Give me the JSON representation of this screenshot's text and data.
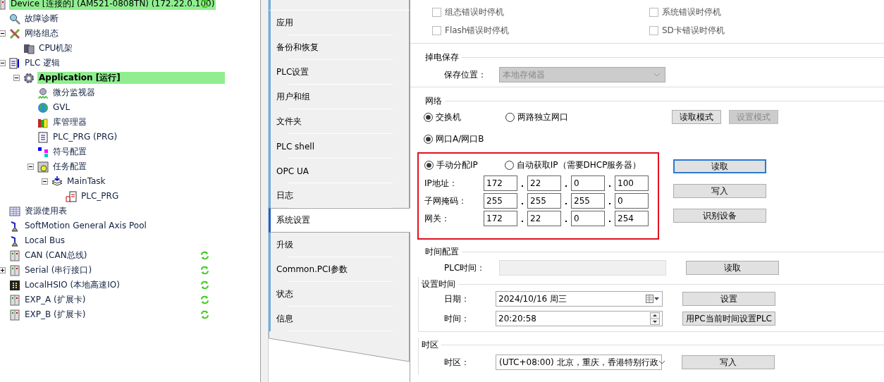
{
  "tree": [
    {
      "label": "Device [连接的] (AM521-0808TN) (172.22.0.100)",
      "kind": "device",
      "selected": true,
      "synced": true,
      "children": [
        {
          "label": "故障诊断",
          "kind": "diagnose",
          "selected": false
        },
        {
          "label": "网络组态",
          "kind": "network",
          "selected": false,
          "expanded": true,
          "children": [
            {
              "label": "CPU机架",
              "kind": "rack",
              "selected": false
            }
          ]
        },
        {
          "label": "PLC 逻辑",
          "kind": "logic",
          "selected": false,
          "expanded": true,
          "children": [
            {
              "label": "Application [运行]",
              "kind": "application",
              "selected": true,
              "expanded": true,
              "children": [
                {
                  "label": "微分监视器",
                  "kind": "monitor",
                  "selected": false
                },
                {
                  "label": "GVL",
                  "kind": "globe",
                  "selected": false
                },
                {
                  "label": "库管理器",
                  "kind": "library",
                  "selected": false
                },
                {
                  "label": "PLC_PRG (PRG)",
                  "kind": "document",
                  "selected": false
                },
                {
                  "label": "符号配置",
                  "kind": "symbols",
                  "selected": false
                },
                {
                  "label": "任务配置",
                  "kind": "tasks",
                  "selected": false,
                  "expanded": true,
                  "children": [
                    {
                      "label": "MainTask",
                      "kind": "task",
                      "selected": false,
                      "expanded": true,
                      "children": [
                        {
                          "label": "PLC_PRG",
                          "kind": "call",
                          "selected": false
                        }
                      ]
                    }
                  ]
                }
              ]
            }
          ]
        },
        {
          "label": "资源使用表",
          "kind": "table",
          "selected": false
        },
        {
          "label": "SoftMotion General Axis Pool",
          "kind": "axis",
          "selected": false
        },
        {
          "label": "Local Bus",
          "kind": "axis",
          "selected": false
        },
        {
          "label": "CAN (CAN总线)",
          "kind": "module",
          "selected": false,
          "synced": true
        },
        {
          "label": "Serial (串行接口)",
          "kind": "module",
          "selected": false,
          "expanded": false,
          "synced": true
        },
        {
          "label": "LocalHSIO (本地高速IO)",
          "kind": "hsio",
          "selected": false,
          "synced": true
        },
        {
          "label": "EXP_A (扩展卡)",
          "kind": "module",
          "selected": false,
          "synced": true
        },
        {
          "label": "EXP_B (扩展卡)",
          "kind": "module",
          "selected": false,
          "synced": true
        }
      ]
    }
  ],
  "tabs": [
    {
      "label": "应用",
      "selected": false
    },
    {
      "label": "备份和恢复",
      "selected": false
    },
    {
      "label": "PLC设置",
      "selected": false
    },
    {
      "label": "用户和组",
      "selected": false
    },
    {
      "label": "文件夹",
      "selected": false
    },
    {
      "label": "PLC shell",
      "selected": false
    },
    {
      "label": "OPC UA",
      "selected": false
    },
    {
      "label": "日志",
      "selected": false
    },
    {
      "label": "系统设置",
      "selected": true
    },
    {
      "label": "升级",
      "selected": false
    },
    {
      "label": "Common.PCI参数",
      "selected": false
    },
    {
      "label": "状态",
      "selected": false
    },
    {
      "label": "信息",
      "selected": false
    }
  ],
  "stop_options": [
    {
      "label": "组态错误时停机",
      "checked": false
    },
    {
      "label": "系统错误时停机",
      "checked": false
    },
    {
      "label": "Flash错误时停机",
      "checked": false
    },
    {
      "label": "SD卡错误时停机",
      "checked": false
    }
  ],
  "retain": {
    "title": "掉电保存",
    "label": "保存位置：",
    "value": "本地存储器",
    "disabled": true
  },
  "network": {
    "title": "网络",
    "modes": [
      {
        "label": "交换机",
        "selected": true
      },
      {
        "label": "两路独立网口",
        "selected": false
      }
    ],
    "mode_buttons": [
      {
        "label": "读取模式",
        "disabled": false
      },
      {
        "label": "设置模式",
        "disabled": true
      }
    ],
    "ports": [
      {
        "label": "网口A/网口B",
        "selected": true
      }
    ],
    "highlighted": true,
    "ip_modes": [
      {
        "label": "手动分配IP",
        "selected": true
      },
      {
        "label": "自动获取IP（需要DHCP服务器）",
        "selected": false
      }
    ],
    "fields": [
      {
        "label": "IP地址：",
        "octets": [
          "172",
          "22",
          "0",
          "100"
        ]
      },
      {
        "label": "子网掩码：",
        "octets": [
          "255",
          "255",
          "255",
          "0"
        ]
      },
      {
        "label": "网关：",
        "octets": [
          "172",
          "22",
          "0",
          "254"
        ]
      }
    ],
    "buttons": [
      {
        "label": "读取",
        "focused": true
      },
      {
        "label": "写入",
        "focused": false
      },
      {
        "label": "识别设备",
        "focused": false
      }
    ]
  },
  "time": {
    "title": "时间配置",
    "plc_label": "PLC时间：",
    "read_button": "读取",
    "set": {
      "title": "设置时间",
      "date_label": "日期：",
      "date": "2024/10/16 周三",
      "time_label": "时间：",
      "time": "20:20:58",
      "set_button": "设置",
      "pc_button": "用PC当前时间设置PLC"
    },
    "zone": {
      "title": "时区",
      "label": "时区：",
      "value": "(UTC+08:00) 北京，重庆，香港特别行政",
      "button": "写入"
    }
  }
}
